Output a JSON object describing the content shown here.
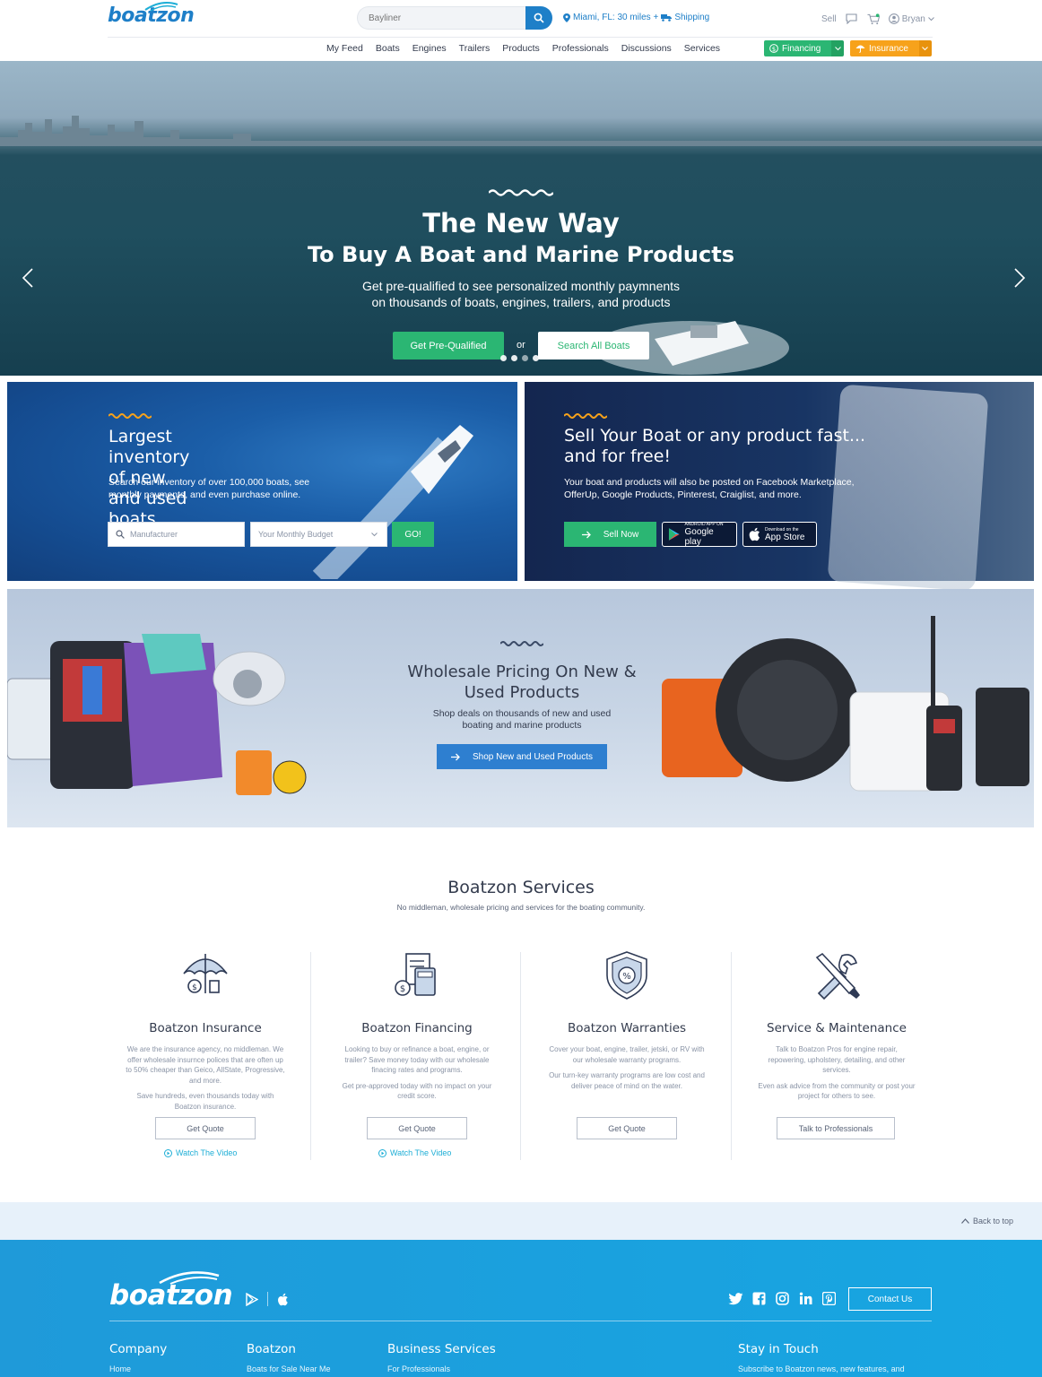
{
  "header": {
    "logo": "boatzon",
    "search_placeholder": "Bayliner",
    "location": "Miami, FL: 30 miles +",
    "shipping": "Shipping",
    "sell": "Sell",
    "user": "Bryan"
  },
  "nav": {
    "items": [
      "My Feed",
      "Boats",
      "Engines",
      "Trailers",
      "Products",
      "Professionals",
      "Discussions",
      "Services"
    ],
    "financing": "Financing",
    "insurance": "Insurance"
  },
  "hero": {
    "title1": "The New Way",
    "title2": "To Buy A Boat and Marine Products",
    "subtitle1": "Get pre-qualified to see personalized monthly paymnents",
    "subtitle2": "on thousands of boats, engines, trailers, and products",
    "btn_prequalified": "Get Pre-Qualified",
    "or": "or",
    "btn_search": "Search All Boats",
    "slides_total": 4,
    "slide_active": 1
  },
  "inventory_card": {
    "title1": "Largest inventory",
    "title2": "of new and used boats",
    "desc1": "Search our inventory of over 100,000 boats, see",
    "desc2": "monthly payments, and even purchase online.",
    "manufacturer_placeholder": "Manufacturer",
    "budget_placeholder": "Your Monthly Budget",
    "go": "GO!"
  },
  "sell_card": {
    "title1": "Sell Your Boat or any product fast...",
    "title2": "and for free!",
    "desc1": "Your boat and products will also be posted on Facebook Marketplace,",
    "desc2": "OfferUp, Google Products, Pinterest, Craiglist, and more.",
    "sell_now": "Sell Now",
    "google_small": "ANDROID APP ON",
    "google_big": "Google play",
    "apple_small": "Download on the",
    "apple_big": "App Store"
  },
  "wholesale": {
    "title1": "Wholesale Pricing On New &",
    "title2": "Used Products",
    "sub1": "Shop deals on thousands of new and used",
    "sub2": "boating and marine products",
    "button": "Shop New and Used Products"
  },
  "services": {
    "title": "Boatzon Services",
    "subtitle": "No middleman, wholesale pricing and services for the boating community.",
    "items": [
      {
        "title": "Boatzon Insurance",
        "desc": "We are the insurance agency, no middleman. We offer wholesale insurnce polices that are often up to 50% cheaper than Geico, AllState, Progressive, and more.",
        "desc2": "Save hundreds, even thousands today with Boatzon insurance.",
        "button": "Get Quote",
        "link": "Watch The Video"
      },
      {
        "title": "Boatzon Financing",
        "desc": "Looking to buy or refinance a boat, engine, or trailer? Save money today with our wholesale finacing rates and programs.",
        "desc2": "Get pre-approved today with no impact on your credit score.",
        "button": "Get Quote",
        "link": "Watch The Video"
      },
      {
        "title": "Boatzon Warranties",
        "desc": "Cover your boat, engine, trailer, jetski, or RV with our wholesale warranty programs.",
        "desc2": "Our turn-key warranty programs are low cost and deliver peace of mind on the water.",
        "button": "Get Quote",
        "link": ""
      },
      {
        "title": "Service & Maintenance",
        "desc": "Talk to Boatzon Pros for engine repair, repowering, upholstery, detailing, and other services.",
        "desc2": "Even ask advice from the community or post your project for others to see.",
        "button": "Talk to Professionals",
        "link": ""
      }
    ]
  },
  "footer": {
    "back_to_top": "Back to top",
    "logo": "boatzon",
    "contact": "Contact Us",
    "columns": [
      {
        "title": "Company",
        "link": "Home"
      },
      {
        "title": "Boatzon",
        "link": "Boats for Sale Near Me"
      },
      {
        "title": "Business Services",
        "link": "For Professionals"
      },
      {
        "title": "Stay in Touch",
        "link": "Subscribe to Boatzon news, new features, and"
      }
    ]
  },
  "colors": {
    "brand_blue": "#1e7fc8",
    "green": "#2bb673",
    "orange": "#f7a21b",
    "footer_blue": "#17a6e2"
  }
}
